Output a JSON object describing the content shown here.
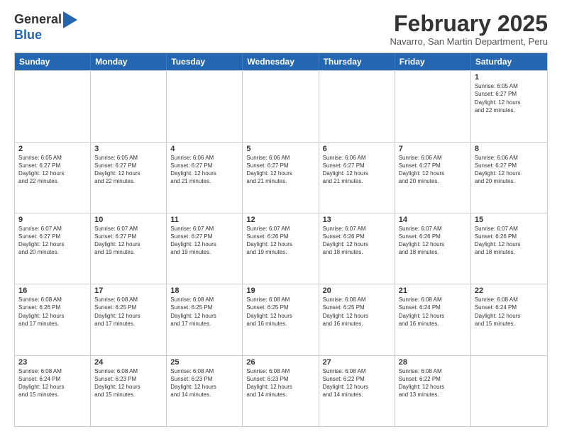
{
  "logo": {
    "general": "General",
    "blue": "Blue"
  },
  "header": {
    "month": "February 2025",
    "location": "Navarro, San Martin Department, Peru"
  },
  "weekdays": [
    "Sunday",
    "Monday",
    "Tuesday",
    "Wednesday",
    "Thursday",
    "Friday",
    "Saturday"
  ],
  "weeks": [
    [
      {
        "day": "",
        "info": ""
      },
      {
        "day": "",
        "info": ""
      },
      {
        "day": "",
        "info": ""
      },
      {
        "day": "",
        "info": ""
      },
      {
        "day": "",
        "info": ""
      },
      {
        "day": "",
        "info": ""
      },
      {
        "day": "1",
        "info": "Sunrise: 6:05 AM\nSunset: 6:27 PM\nDaylight: 12 hours\nand 22 minutes."
      }
    ],
    [
      {
        "day": "2",
        "info": "Sunrise: 6:05 AM\nSunset: 6:27 PM\nDaylight: 12 hours\nand 22 minutes."
      },
      {
        "day": "3",
        "info": "Sunrise: 6:05 AM\nSunset: 6:27 PM\nDaylight: 12 hours\nand 22 minutes."
      },
      {
        "day": "4",
        "info": "Sunrise: 6:06 AM\nSunset: 6:27 PM\nDaylight: 12 hours\nand 21 minutes."
      },
      {
        "day": "5",
        "info": "Sunrise: 6:06 AM\nSunset: 6:27 PM\nDaylight: 12 hours\nand 21 minutes."
      },
      {
        "day": "6",
        "info": "Sunrise: 6:06 AM\nSunset: 6:27 PM\nDaylight: 12 hours\nand 21 minutes."
      },
      {
        "day": "7",
        "info": "Sunrise: 6:06 AM\nSunset: 6:27 PM\nDaylight: 12 hours\nand 20 minutes."
      },
      {
        "day": "8",
        "info": "Sunrise: 6:06 AM\nSunset: 6:27 PM\nDaylight: 12 hours\nand 20 minutes."
      }
    ],
    [
      {
        "day": "9",
        "info": "Sunrise: 6:07 AM\nSunset: 6:27 PM\nDaylight: 12 hours\nand 20 minutes."
      },
      {
        "day": "10",
        "info": "Sunrise: 6:07 AM\nSunset: 6:27 PM\nDaylight: 12 hours\nand 19 minutes."
      },
      {
        "day": "11",
        "info": "Sunrise: 6:07 AM\nSunset: 6:27 PM\nDaylight: 12 hours\nand 19 minutes."
      },
      {
        "day": "12",
        "info": "Sunrise: 6:07 AM\nSunset: 6:26 PM\nDaylight: 12 hours\nand 19 minutes."
      },
      {
        "day": "13",
        "info": "Sunrise: 6:07 AM\nSunset: 6:26 PM\nDaylight: 12 hours\nand 18 minutes."
      },
      {
        "day": "14",
        "info": "Sunrise: 6:07 AM\nSunset: 6:26 PM\nDaylight: 12 hours\nand 18 minutes."
      },
      {
        "day": "15",
        "info": "Sunrise: 6:07 AM\nSunset: 6:26 PM\nDaylight: 12 hours\nand 18 minutes."
      }
    ],
    [
      {
        "day": "16",
        "info": "Sunrise: 6:08 AM\nSunset: 6:26 PM\nDaylight: 12 hours\nand 17 minutes."
      },
      {
        "day": "17",
        "info": "Sunrise: 6:08 AM\nSunset: 6:25 PM\nDaylight: 12 hours\nand 17 minutes."
      },
      {
        "day": "18",
        "info": "Sunrise: 6:08 AM\nSunset: 6:25 PM\nDaylight: 12 hours\nand 17 minutes."
      },
      {
        "day": "19",
        "info": "Sunrise: 6:08 AM\nSunset: 6:25 PM\nDaylight: 12 hours\nand 16 minutes."
      },
      {
        "day": "20",
        "info": "Sunrise: 6:08 AM\nSunset: 6:25 PM\nDaylight: 12 hours\nand 16 minutes."
      },
      {
        "day": "21",
        "info": "Sunrise: 6:08 AM\nSunset: 6:24 PM\nDaylight: 12 hours\nand 16 minutes."
      },
      {
        "day": "22",
        "info": "Sunrise: 6:08 AM\nSunset: 6:24 PM\nDaylight: 12 hours\nand 15 minutes."
      }
    ],
    [
      {
        "day": "23",
        "info": "Sunrise: 6:08 AM\nSunset: 6:24 PM\nDaylight: 12 hours\nand 15 minutes."
      },
      {
        "day": "24",
        "info": "Sunrise: 6:08 AM\nSunset: 6:23 PM\nDaylight: 12 hours\nand 15 minutes."
      },
      {
        "day": "25",
        "info": "Sunrise: 6:08 AM\nSunset: 6:23 PM\nDaylight: 12 hours\nand 14 minutes."
      },
      {
        "day": "26",
        "info": "Sunrise: 6:08 AM\nSunset: 6:23 PM\nDaylight: 12 hours\nand 14 minutes."
      },
      {
        "day": "27",
        "info": "Sunrise: 6:08 AM\nSunset: 6:22 PM\nDaylight: 12 hours\nand 14 minutes."
      },
      {
        "day": "28",
        "info": "Sunrise: 6:08 AM\nSunset: 6:22 PM\nDaylight: 12 hours\nand 13 minutes."
      },
      {
        "day": "",
        "info": ""
      }
    ]
  ]
}
